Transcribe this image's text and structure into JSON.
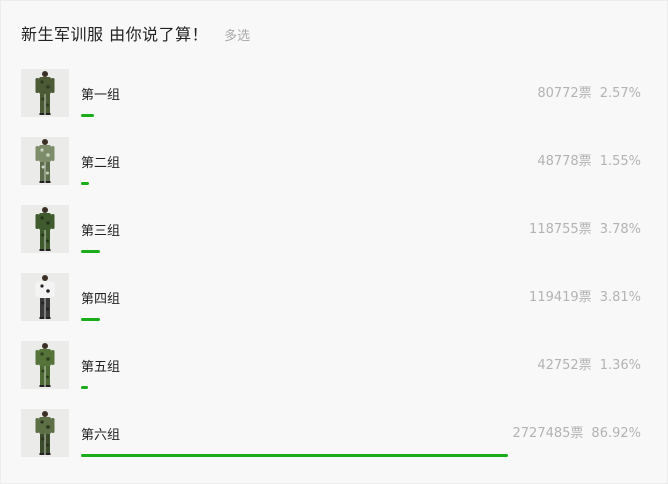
{
  "poll": {
    "title": "新生军训服 由你说了算！",
    "mode": "多选",
    "accent_color": "#1aad19",
    "options": [
      {
        "label": "第一组",
        "votes": "80772票",
        "percent": "2.57%",
        "fraction": 0.0257,
        "image_icon": "camo-uniform-photo",
        "shirt": "#4d5a36",
        "pants": "#4a5a34",
        "pattern": "#2f3a22"
      },
      {
        "label": "第二组",
        "votes": "48778票",
        "percent": "1.55%",
        "fraction": 0.0155,
        "image_icon": "camo-uniform-photo",
        "shirt": "#7d8d6a",
        "pants": "#5e6e4c",
        "pattern": "#c9d1c0"
      },
      {
        "label": "第三组",
        "votes": "118755票",
        "percent": "3.78%",
        "fraction": 0.0378,
        "image_icon": "camo-uniform-photo",
        "shirt": "#3f5a2c",
        "pants": "#3f5a2c",
        "pattern": "#24331a"
      },
      {
        "label": "第四组",
        "votes": "119419票",
        "percent": "3.81%",
        "fraction": 0.0381,
        "image_icon": "camo-uniform-photo",
        "shirt": "#f4f4f4",
        "pants": "#3a3a3a",
        "pattern": "#222222"
      },
      {
        "label": "第五组",
        "votes": "42752票",
        "percent": "1.36%",
        "fraction": 0.0136,
        "image_icon": "camo-uniform-photo",
        "shirt": "#56743a",
        "pants": "#4d6a34",
        "pattern": "#2c3e1e"
      },
      {
        "label": "第六组",
        "votes": "2727485票",
        "percent": "86.92%",
        "fraction": 0.8692,
        "image_icon": "camo-uniform-photo",
        "shirt": "#5d6f45",
        "pants": "#3c4a2c",
        "pattern": "#2a331e"
      }
    ]
  }
}
